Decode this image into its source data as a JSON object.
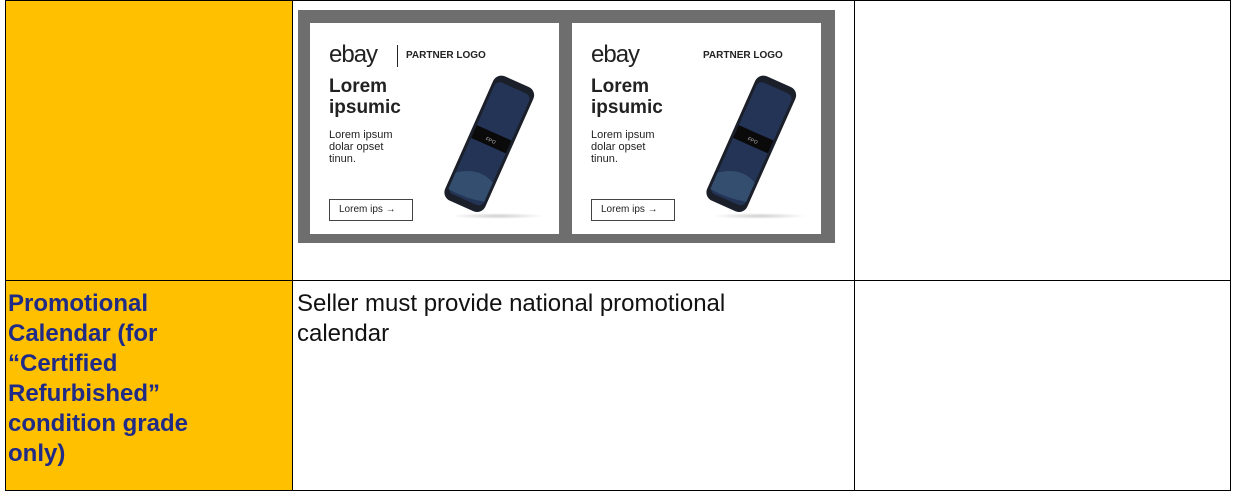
{
  "table": {
    "rows": [
      {
        "label": "",
        "value": "",
        "notes": "",
        "banner": {
          "ads": [
            {
              "logo": "ebay",
              "partner": "PARTNER LOGO",
              "title": "Lorem\nipsumic",
              "body": "Lorem ipsum\ndolar opset\ntinun.",
              "button": "Lorem ips →",
              "phone_tag": "FPO"
            },
            {
              "logo": "ebay",
              "partner": "PARTNER LOGO",
              "title": "Lorem\nipsumic",
              "body": "Lorem ipsum\ndolar opset\ntinun.",
              "button": "Lorem ips →",
              "phone_tag": "FPO"
            }
          ]
        }
      },
      {
        "label": "Promotional\nCalendar (for\n“Certified\nRefurbished”\ncondition grade\nonly)",
        "value": "Seller must provide national promotional\ncalendar",
        "notes": ""
      }
    ]
  },
  "colors": {
    "label_bg": "#FFC000",
    "label_text": "#1F2B86",
    "frame": "#6e6e6e"
  }
}
